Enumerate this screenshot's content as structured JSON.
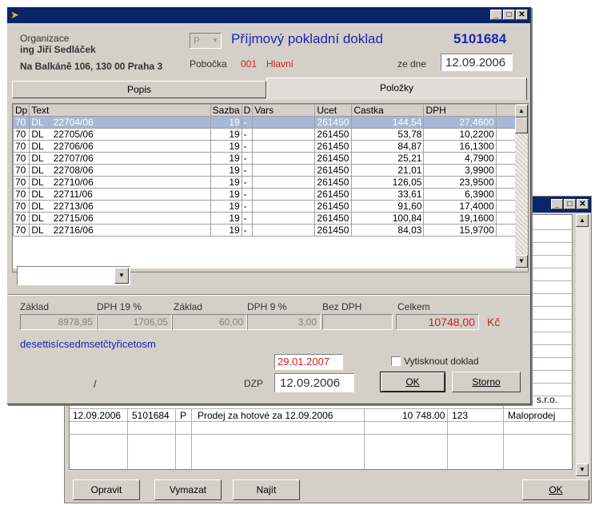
{
  "main": {
    "org_label": "Organizace",
    "org_name": "ing Jiří Sedláček",
    "org_address": "Na Balkáně 106, 130 00 Praha 3",
    "type_code": "P",
    "doc_title": "Příjmový pokladní doklad",
    "doc_number": "5101684",
    "branch_label": "Pobočka",
    "branch_code": "001",
    "branch_name": "Hlavní",
    "date_label": "ze dne",
    "date_value": "12.09.2006",
    "tabs": [
      "Popis",
      "Položky"
    ],
    "columns": [
      "Dp",
      "Text",
      "Sazba",
      "D",
      "Vars",
      "Ucet",
      "Castka",
      "DPH"
    ],
    "rows": [
      [
        "70",
        "DL",
        "22704/06",
        "19",
        "-",
        "",
        "261450",
        "144,54",
        "27,4600"
      ],
      [
        "70",
        "DL",
        "22705/06",
        "19",
        "-",
        "",
        "261450",
        "53,78",
        "10,2200"
      ],
      [
        "70",
        "DL",
        "22706/06",
        "19",
        "-",
        "",
        "261450",
        "84,87",
        "16,1300"
      ],
      [
        "70",
        "DL",
        "22707/06",
        "19",
        "-",
        "",
        "261450",
        "25,21",
        "4,7900"
      ],
      [
        "70",
        "DL",
        "22708/06",
        "19",
        "-",
        "",
        "261450",
        "21,01",
        "3,9900"
      ],
      [
        "70",
        "DL",
        "22710/06",
        "19",
        "-",
        "",
        "261450",
        "126,05",
        "23,9500"
      ],
      [
        "70",
        "DL",
        "22711/06",
        "19",
        "-",
        "",
        "261450",
        "33,61",
        "6,3900"
      ],
      [
        "70",
        "DL",
        "22713/06",
        "19",
        "-",
        "",
        "261450",
        "91,60",
        "17,4000"
      ],
      [
        "70",
        "DL",
        "22715/06",
        "19",
        "-",
        "",
        "261450",
        "100,84",
        "19,1600"
      ],
      [
        "70",
        "DL",
        "22716/06",
        "19",
        "-",
        "",
        "261450",
        "84,03",
        "15,9700"
      ]
    ],
    "summary_labels": {
      "zaklad1": "Základ",
      "dph19": "DPH 19 %",
      "zaklad2": "Základ",
      "dph9": "DPH 9 %",
      "bez_dph": "Bez DPH",
      "celkem": "Celkem"
    },
    "summary_values": {
      "zaklad1": "8978,95",
      "dph19": "1706,05",
      "zaklad2": "60,00",
      "dph9": "3,00",
      "bez_dph": "",
      "celkem": "10748,00"
    },
    "currency": "Kč",
    "amount_words": "desettisícsedmsetčtyřicetosm",
    "red_date": "29.01.2007",
    "print_checkbox_label": "Vytisknout doklad",
    "slash": "/",
    "dzp_label": "DZP",
    "dzp_value": "12.09.2006",
    "ok_button": "OK",
    "storno_button": "Storno"
  },
  "background": {
    "partial_text": "s.r.o.",
    "row": {
      "date": "12.09.2006",
      "number": "5101684",
      "type": "P",
      "text": "Prodej za hotové za 12.09.2006",
      "amount": "10 748.00",
      "code": "123",
      "category": "Maloprodej"
    },
    "buttons": {
      "opravit": "Opravit",
      "vymazat": "Vymazat",
      "najit": "Najít",
      "ok": "OK"
    }
  },
  "colors": {
    "title_blue": "#1c23b8",
    "red": "#d02020",
    "selection": "#a6b8d4",
    "titlebar": "#0a246a"
  }
}
